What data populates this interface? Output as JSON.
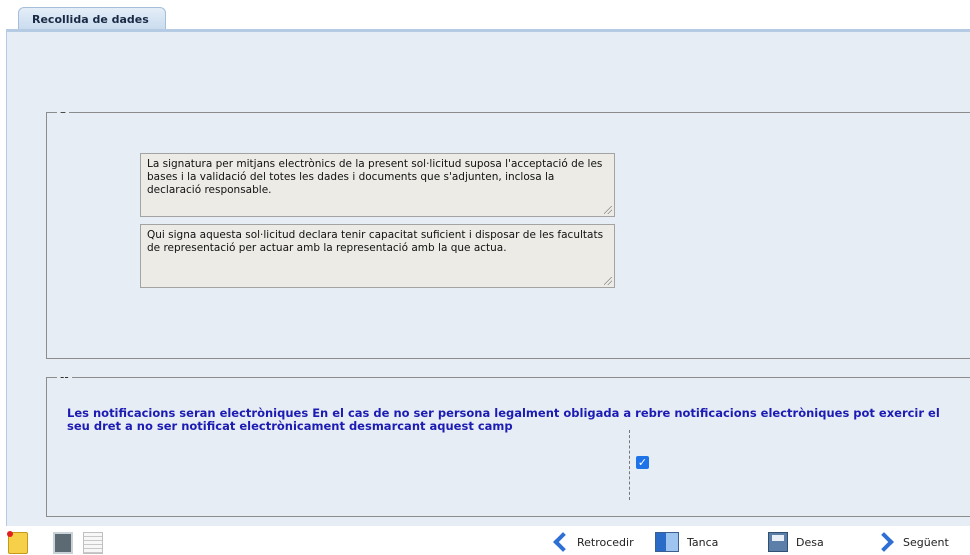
{
  "tab": {
    "label": "Recollida de dades"
  },
  "section1": {
    "legend": "–",
    "text1": "La signatura per mitjans electrònics de la present sol·licitud suposa l'acceptació de les bases i la validació del totes les dades i documents que s'adjunten, inclosa la declaració responsable.",
    "text2": "Qui signa aquesta sol·licitud declara tenir capacitat suficient i disposar de les facultats de representació per actuar amb la representació amb la que actua."
  },
  "section2": {
    "legend": "--",
    "notice": "Les notificacions seran electròniques En el cas de no ser persona legalment obligada a rebre notificacions electròniques pot exercir el seu dret a no ser notificat electrònicament desmarcant aquest camp",
    "checkbox_checked": true,
    "checkbox_mark": "✓"
  },
  "toolbar": {
    "back_label": "Retrocedir",
    "close_label": "Tanca",
    "save_label": "Desa",
    "next_label": "Següent"
  },
  "icons": {
    "folder": "folder-icon",
    "contact": "contact-card-icon",
    "document": "document-icon",
    "back": "chevron-left-icon",
    "close": "exit-door-icon",
    "save": "floppy-disk-icon",
    "next": "chevron-right-icon"
  },
  "colors": {
    "panel_bg": "#e7edf4",
    "notice_text": "#1c1cb4",
    "checkbox": "#1e73e8",
    "chevron": "#2e6fd4"
  }
}
